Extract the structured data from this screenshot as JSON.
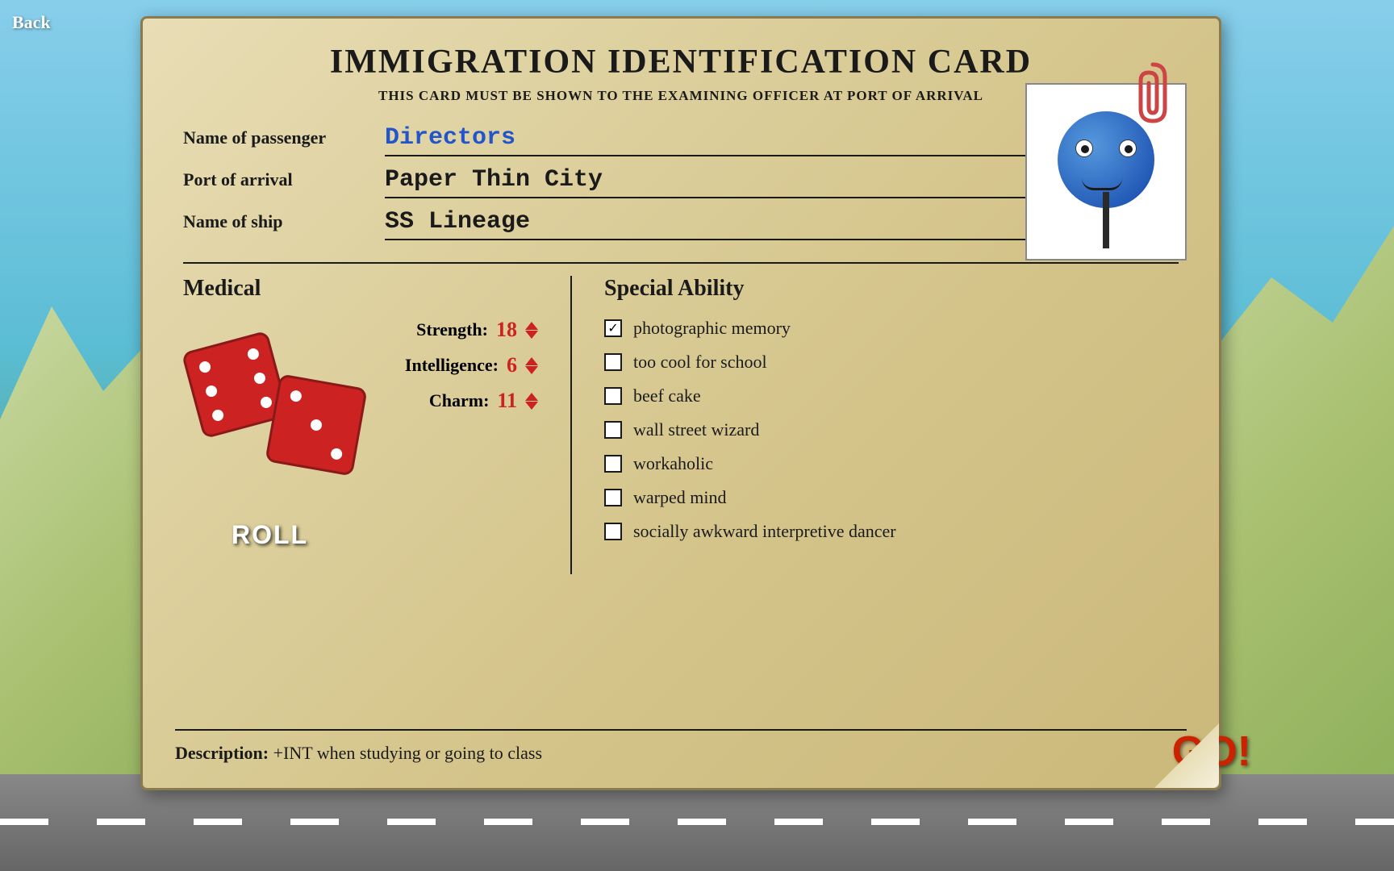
{
  "background": {
    "color": "#5bbdd4"
  },
  "back_button": {
    "label": "Back"
  },
  "go_button": {
    "label": "GO!"
  },
  "card": {
    "title": "IMMIGRATION IDENTIFICATION CARD",
    "subtitle": "THIS CARD MUST BE SHOWN TO THE EXAMINING OFFICER AT PORT OF ARRIVAL",
    "fields": {
      "passenger_label": "Name of passenger",
      "passenger_value": "Directors",
      "port_label": "Port of arrival",
      "port_value": "Paper  Thin  City",
      "ship_label": "Name of ship",
      "ship_value": "SS  Lineage"
    },
    "medical": {
      "header": "Medical",
      "strength_label": "Strength:",
      "strength_value": "18",
      "intelligence_label": "Intelligence:",
      "intelligence_value": "6",
      "charm_label": "Charm:",
      "charm_value": "11"
    },
    "special_ability": {
      "header": "Special Ability",
      "abilities": [
        {
          "label": "photographic memory",
          "checked": true
        },
        {
          "label": "too cool for school",
          "checked": false
        },
        {
          "label": "beef cake",
          "checked": false
        },
        {
          "label": "wall street wizard",
          "checked": false
        },
        {
          "label": "workaholic",
          "checked": false
        },
        {
          "label": "warped mind",
          "checked": false
        },
        {
          "label": "socially awkward interpretive dancer",
          "checked": false
        }
      ]
    },
    "description": {
      "label": "Description:",
      "text": "+INT when studying or going to class"
    }
  },
  "dice": {
    "roll_label": "ROLL"
  }
}
